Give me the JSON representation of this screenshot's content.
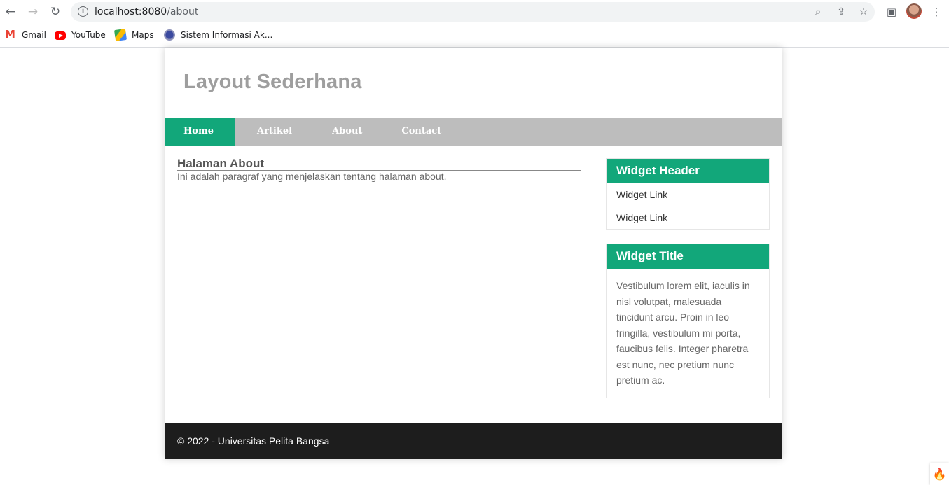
{
  "browser": {
    "url_host": "localhost:8080",
    "url_path": "/about",
    "bookmarks": [
      {
        "label": "Gmail",
        "icon": "gmail-icon"
      },
      {
        "label": "YouTube",
        "icon": "youtube-icon"
      },
      {
        "label": "Maps",
        "icon": "maps-icon"
      },
      {
        "label": "Sistem Informasi Ak...",
        "icon": "sistem-informasi-icon"
      }
    ]
  },
  "site": {
    "title": "Layout Sederhana",
    "nav": [
      {
        "label": "Home",
        "active": true
      },
      {
        "label": "Artikel",
        "active": false
      },
      {
        "label": "About",
        "active": false
      },
      {
        "label": "Contact",
        "active": false
      }
    ]
  },
  "content": {
    "heading": "Halaman About",
    "paragraph": "Ini adalah paragraf yang menjelaskan tentang halaman about."
  },
  "sidebar": {
    "widget1": {
      "header": "Widget Header",
      "links": [
        "Widget Link",
        "Widget Link"
      ]
    },
    "widget2": {
      "header": "Widget Title",
      "body": "Vestibulum lorem elit, iaculis in nisl volutpat, malesuada tincidunt arcu. Proin in leo fringilla, vestibulum mi porta, faucibus felis. Integer pharetra est nunc, nec pretium nunc pretium ac."
    }
  },
  "footer": {
    "text": "© 2022 - Universitas Pelita Bangsa"
  },
  "colors": {
    "accent": "#12a77a",
    "nav_bg": "#bdbdbd",
    "footer_bg": "#1d1d1d",
    "title": "#9e9e9e"
  }
}
